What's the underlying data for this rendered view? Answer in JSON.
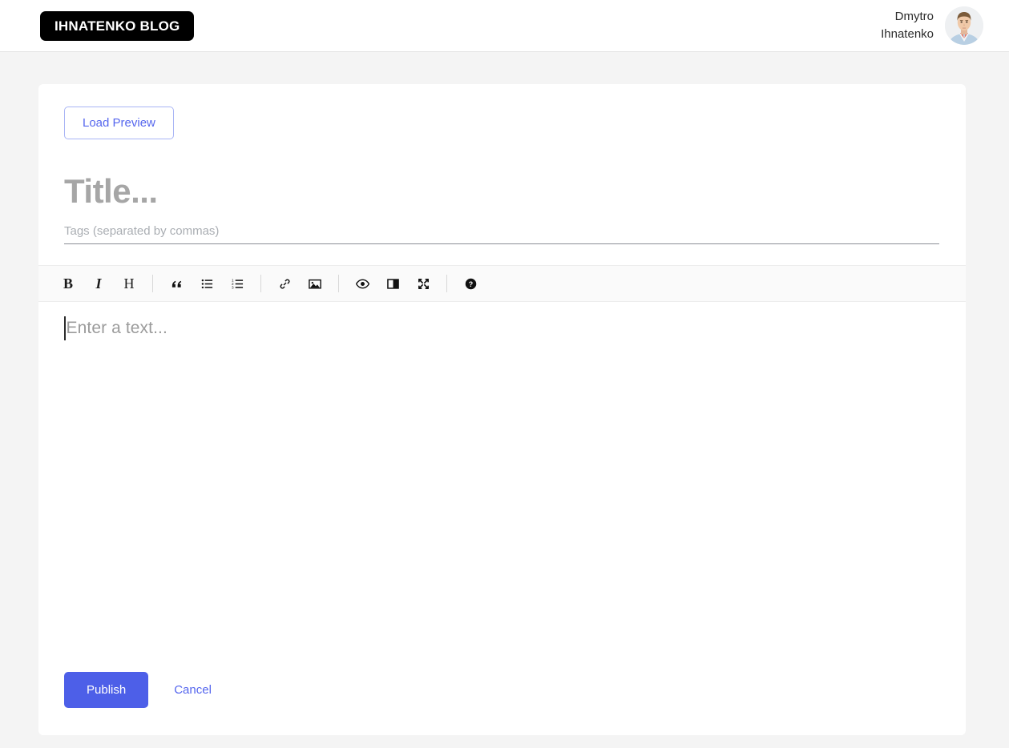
{
  "header": {
    "logo_text": "IHNATENKO BLOG",
    "user_name": "Dmytro Ihnatenko",
    "avatar_icon": "user-avatar-photo"
  },
  "editor_page": {
    "load_preview_label": "Load Preview",
    "title_placeholder": "Title...",
    "title_value": "",
    "tags_placeholder": "Tags (separated by commas)",
    "tags_value": "",
    "body_placeholder": "Enter a text...",
    "body_value": "",
    "toolbar": [
      {
        "name": "bold-icon",
        "glyph": "B",
        "tooltip": "Bold"
      },
      {
        "name": "italic-icon",
        "glyph": "I",
        "tooltip": "Italic"
      },
      {
        "name": "heading-icon",
        "glyph": "H",
        "tooltip": "Heading"
      },
      {
        "name": "quote-icon",
        "glyph": "“",
        "tooltip": "Quote"
      },
      {
        "name": "unordered-list-icon",
        "glyph": "",
        "tooltip": "Generic List"
      },
      {
        "name": "ordered-list-icon",
        "glyph": "",
        "tooltip": "Numbered List"
      },
      {
        "name": "link-icon",
        "glyph": "",
        "tooltip": "Create Link"
      },
      {
        "name": "image-icon",
        "glyph": "",
        "tooltip": "Insert Image"
      },
      {
        "name": "preview-eye-icon",
        "glyph": "",
        "tooltip": "Toggle Preview"
      },
      {
        "name": "side-by-side-icon",
        "glyph": "",
        "tooltip": "Toggle Side by Side"
      },
      {
        "name": "fullscreen-icon",
        "glyph": "",
        "tooltip": "Toggle Fullscreen"
      },
      {
        "name": "help-question-icon",
        "glyph": "?",
        "tooltip": "Markdown Guide"
      }
    ],
    "publish_label": "Publish",
    "cancel_label": "Cancel"
  },
  "colors": {
    "accent": "#4d5fe8",
    "accent_link": "#5566ee",
    "page_bg": "#f4f4f4",
    "card_bg": "#ffffff",
    "toolbar_bg": "#fafafa",
    "logo_bg": "#000000"
  }
}
